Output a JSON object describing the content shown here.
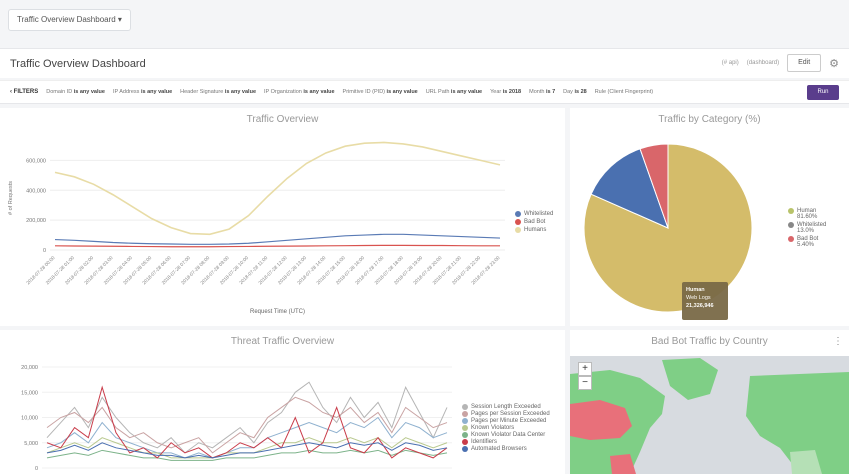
{
  "topbar": {
    "dashboard_select": "Traffic Overview Dashboard ▾"
  },
  "titlebar": {
    "title": "Traffic Overview Dashboard",
    "meta1": "(# api)",
    "meta2": "(dashboard)",
    "edit": "Edit"
  },
  "filters": {
    "label": "FILTERS",
    "items": [
      {
        "k": "Domain ID",
        "v": "is any value"
      },
      {
        "k": "IP Address",
        "v": "is any value"
      },
      {
        "k": "Header Signature",
        "v": "is any value"
      },
      {
        "k": "IP Organization",
        "v": "is any value"
      },
      {
        "k": "Primitive ID (PID)",
        "v": "is any value"
      },
      {
        "k": "URL Path",
        "v": "is any value"
      },
      {
        "k": "Year",
        "v": "is 2018"
      },
      {
        "k": "Month",
        "v": "is 7"
      },
      {
        "k": "Day",
        "v": "is 28"
      },
      {
        "k": "Rule (Client Fingerprint)",
        "v": ""
      }
    ],
    "run": "Run"
  },
  "chart_data": [
    {
      "type": "line",
      "title": "Traffic Overview",
      "xlabel": "Request Time (UTC)",
      "ylabel": "# of Requests",
      "yticks": [
        "600,000",
        "400,000",
        "200,000",
        "0"
      ],
      "ylim": [
        0,
        750000
      ],
      "x": [
        "2018-07-28 00:00",
        "2018-07-28 01:00",
        "2018-07-28 02:00",
        "2018-07-28 03:00",
        "2018-07-28 04:00",
        "2018-07-28 05:00",
        "2018-07-28 06:00",
        "2018-07-28 07:00",
        "2018-07-28 08:00",
        "2018-07-28 09:00",
        "2018-07-28 10:00",
        "2018-07-28 11:00",
        "2018-07-28 12:00",
        "2018-07-28 13:00",
        "2018-07-28 14:00",
        "2018-07-28 15:00",
        "2018-07-28 16:00",
        "2018-07-28 17:00",
        "2018-07-28 18:00",
        "2018-07-28 19:00",
        "2018-07-28 20:00",
        "2018-07-28 21:00",
        "2018-07-28 22:00",
        "2018-07-28 23:00"
      ],
      "series": [
        {
          "name": "Whitelisted",
          "color": "#5a7bb5",
          "values": [
            70000,
            65000,
            58000,
            50000,
            45000,
            42000,
            40000,
            38000,
            38000,
            40000,
            45000,
            55000,
            65000,
            75000,
            85000,
            95000,
            100000,
            105000,
            105000,
            100000,
            95000,
            90000,
            85000,
            80000
          ]
        },
        {
          "name": "Bad Bot",
          "color": "#d9534f",
          "values": [
            28000,
            27000,
            26000,
            25000,
            24000,
            23000,
            22000,
            22000,
            22000,
            23000,
            24000,
            25000,
            26000,
            27000,
            28000,
            29000,
            30000,
            31000,
            31000,
            30000,
            30000,
            29000,
            28000,
            28000
          ]
        },
        {
          "name": "Humans",
          "color": "#e8dca6",
          "values": [
            520000,
            490000,
            440000,
            370000,
            290000,
            210000,
            150000,
            110000,
            105000,
            140000,
            230000,
            360000,
            480000,
            580000,
            650000,
            695000,
            715000,
            720000,
            710000,
            690000,
            660000,
            630000,
            600000,
            570000
          ]
        }
      ]
    },
    {
      "type": "pie",
      "title": "Traffic by Category (%)",
      "slices": [
        {
          "name": "Human",
          "pct": 81.6,
          "color": "#d4bc6a"
        },
        {
          "name": "Whitelisted",
          "pct": 13.0,
          "color": "#4a70b0"
        },
        {
          "name": "Bad Bot",
          "pct": 5.4,
          "color": "#d9666a"
        }
      ],
      "legend": [
        {
          "label": "Human",
          "sub": "81.60%",
          "color": "#b8c36a"
        },
        {
          "label": "Whitelisted",
          "sub": "13.0%",
          "color": "#888"
        },
        {
          "label": "Bad Bot",
          "sub": "5.40%",
          "color": "#d9666a"
        }
      ],
      "tooltip": {
        "line1": "Human",
        "line2": "Web Logs",
        "line3": "21,326,946"
      }
    },
    {
      "type": "line",
      "title": "Threat Traffic Overview",
      "yticks": [
        "20,000",
        "15,000",
        "10,000",
        "5,000",
        "0"
      ],
      "ylim": [
        0,
        21000
      ],
      "series": [
        {
          "name": "Session Length Exceeded",
          "color": "#b5b5b5",
          "values": [
            6000,
            9000,
            12000,
            8000,
            14000,
            10000,
            7000,
            5000,
            4000,
            6000,
            3000,
            5000,
            4000,
            6000,
            8000,
            5000,
            9000,
            11000,
            15000,
            17000,
            12000,
            9000,
            14000,
            10000,
            13000,
            8000,
            16000,
            11000,
            6000,
            12000
          ]
        },
        {
          "name": "Pages per Session Exceeded",
          "color": "#c9a3a3",
          "values": [
            8000,
            10000,
            11000,
            9000,
            12000,
            8000,
            6000,
            7000,
            5000,
            4000,
            5000,
            6000,
            3000,
            5000,
            7000,
            6000,
            10000,
            12000,
            14000,
            13000,
            11000,
            10000,
            12000,
            9000,
            11000,
            7000,
            12000,
            10000,
            8000,
            9000
          ]
        },
        {
          "name": "Pages per Minute Exceeded",
          "color": "#8fb1cf",
          "values": [
            4000,
            5000,
            7000,
            5000,
            9000,
            6000,
            5000,
            4000,
            3000,
            3000,
            2000,
            3000,
            2000,
            3000,
            4000,
            4000,
            6000,
            7000,
            8000,
            9000,
            8000,
            7000,
            9000,
            8000,
            10000,
            6000,
            9000,
            8000,
            6000,
            7000
          ]
        },
        {
          "name": "Known Violators",
          "color": "#b9c98f",
          "values": [
            3000,
            4000,
            5000,
            4000,
            6000,
            5000,
            4000,
            3000,
            3000,
            2000,
            2000,
            2000,
            2000,
            3000,
            3000,
            3000,
            4000,
            5000,
            5000,
            6000,
            5000,
            5000,
            6000,
            5000,
            6000,
            4000,
            6000,
            5000,
            4000,
            5000
          ]
        },
        {
          "name": "Known Violator Data Center",
          "color": "#7db38a",
          "values": [
            2000,
            2500,
            3000,
            2500,
            3500,
            3000,
            2500,
            2000,
            2000,
            1500,
            1500,
            1500,
            1500,
            2000,
            2000,
            2000,
            2500,
            3000,
            3000,
            3500,
            3000,
            3000,
            3500,
            3000,
            3500,
            2500,
            3500,
            3000,
            2500,
            3000
          ]
        },
        {
          "name": "Identifiers",
          "color": "#c93c4a",
          "values": [
            5000,
            4000,
            8000,
            6000,
            16000,
            7000,
            3000,
            4000,
            2000,
            5000,
            3000,
            4000,
            2000,
            3000,
            5000,
            4000,
            6000,
            4000,
            10000,
            3000,
            5000,
            12000,
            4000,
            3000,
            6000,
            2000,
            4000,
            3000,
            2000,
            4000
          ]
        },
        {
          "name": "Automated Browsers",
          "color": "#4a6fb0",
          "values": [
            3000,
            3500,
            4500,
            3500,
            5000,
            4000,
            3500,
            3000,
            2500,
            2500,
            2000,
            2500,
            2000,
            2500,
            3000,
            3000,
            3500,
            4000,
            4500,
            5000,
            4500,
            4000,
            5000,
            4500,
            5000,
            3500,
            5000,
            4500,
            3500,
            4000
          ]
        }
      ]
    }
  ],
  "map": {
    "title": "Bad Bot Traffic by Country",
    "zoom_in": "+",
    "zoom_out": "−",
    "menu": "⋮"
  },
  "colors": {
    "accent": "#5a3d8c"
  }
}
